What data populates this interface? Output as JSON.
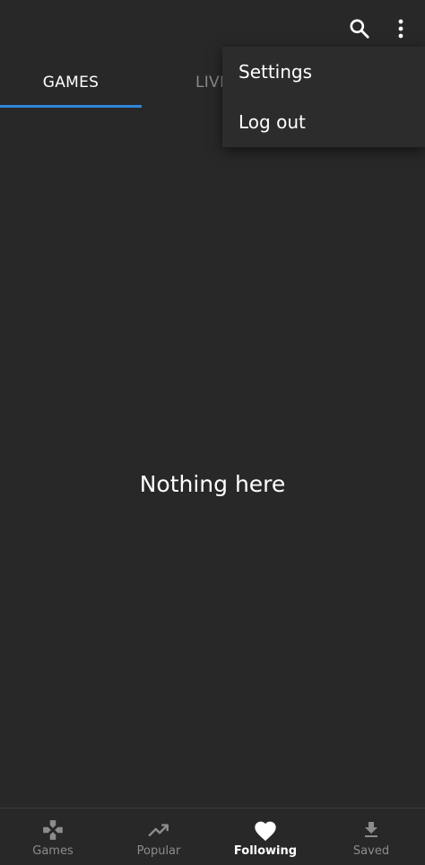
{
  "app_bar": {
    "icons": [
      "search-icon",
      "more-vert-icon"
    ]
  },
  "tabs": [
    {
      "label": "GAMES",
      "active": true
    },
    {
      "label": "LIVE",
      "active": false
    }
  ],
  "menu": {
    "items": [
      {
        "label": "Settings"
      },
      {
        "label": "Log out"
      }
    ]
  },
  "main": {
    "empty_text": "Nothing here"
  },
  "bottom_nav": {
    "items": [
      {
        "label": "Games",
        "icon": "gamepad-icon",
        "active": false
      },
      {
        "label": "Popular",
        "icon": "trending-up-icon",
        "active": false
      },
      {
        "label": "Following",
        "icon": "heart-icon",
        "active": true
      },
      {
        "label": "Saved",
        "icon": "download-icon",
        "active": false
      }
    ]
  },
  "colors": {
    "background": "#282828",
    "accent": "#2f87d8",
    "text": "#ffffff",
    "inactive": "#8c8c8c"
  }
}
